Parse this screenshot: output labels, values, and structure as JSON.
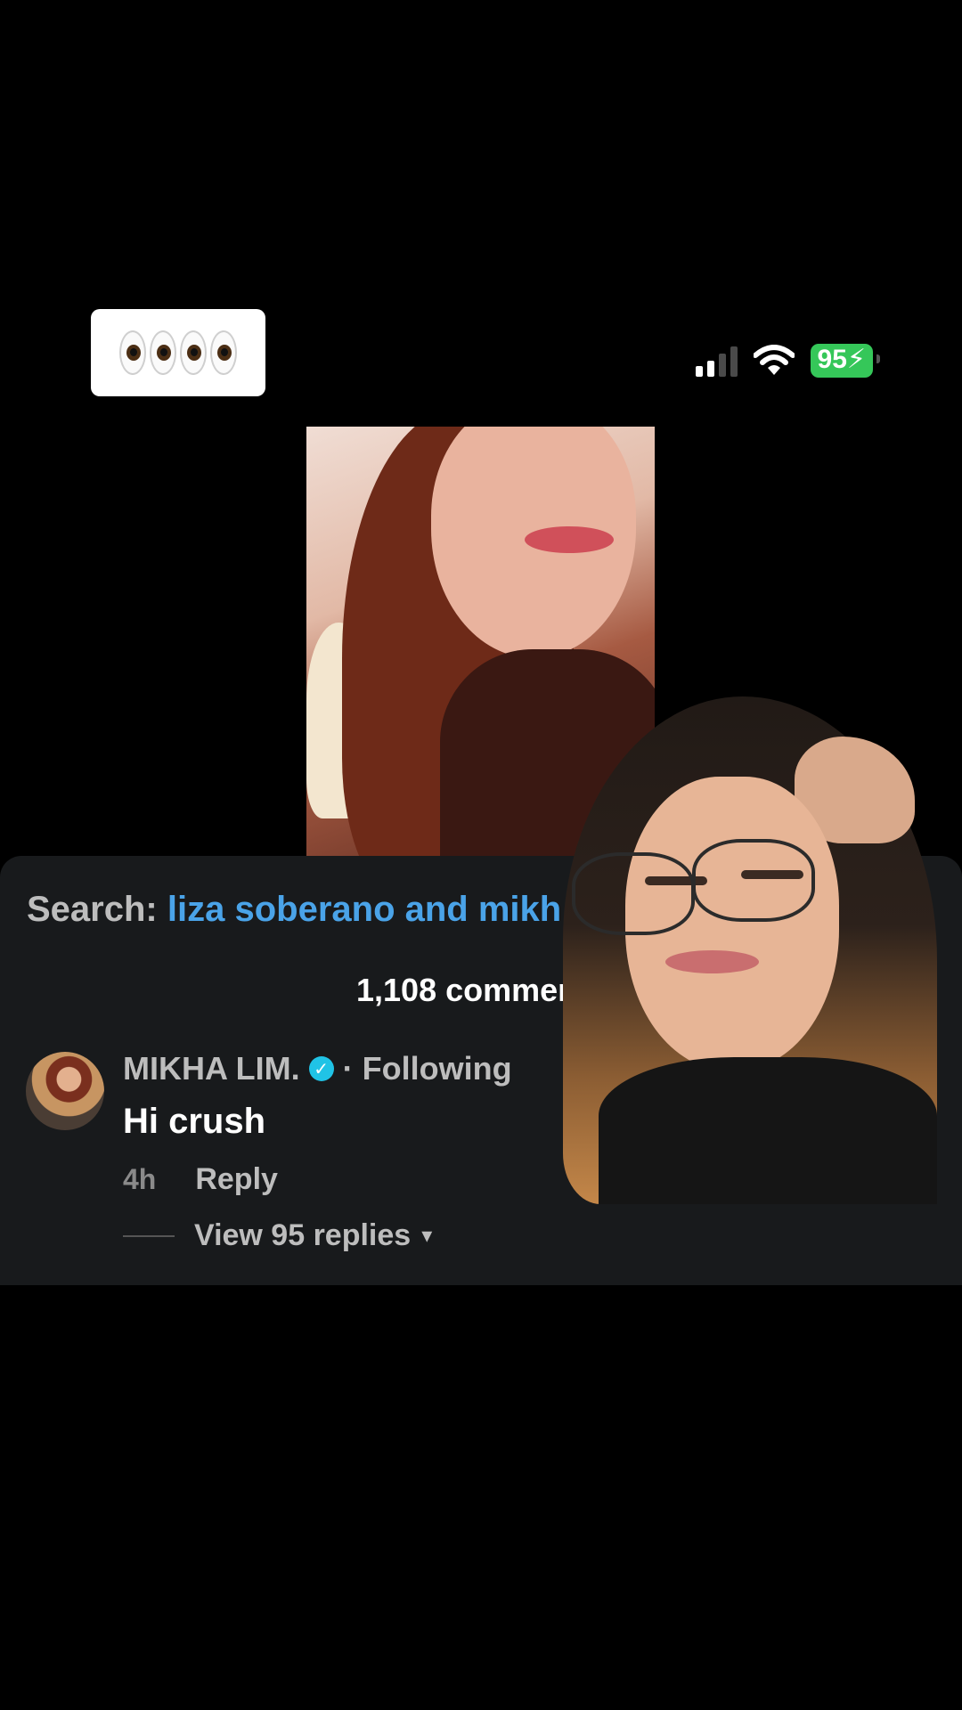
{
  "status_bar": {
    "battery": "95"
  },
  "sticker": {
    "emoji": "eyes-emoji"
  },
  "comments_panel": {
    "search_label": "Search:",
    "search_query": "liza soberano and mikh",
    "comment_count": "1,108 comment",
    "comment": {
      "username": "MIKHA LIM.",
      "separator": "·",
      "following": "Following",
      "text": "Hi crush",
      "time": "4h",
      "reply_label": "Reply",
      "view_replies": "View 95 replies"
    }
  },
  "colors": {
    "panel_bg": "#181a1c",
    "query_blue": "#4aa3e8",
    "battery_green": "#35c759",
    "verified_blue": "#20c3e6"
  }
}
